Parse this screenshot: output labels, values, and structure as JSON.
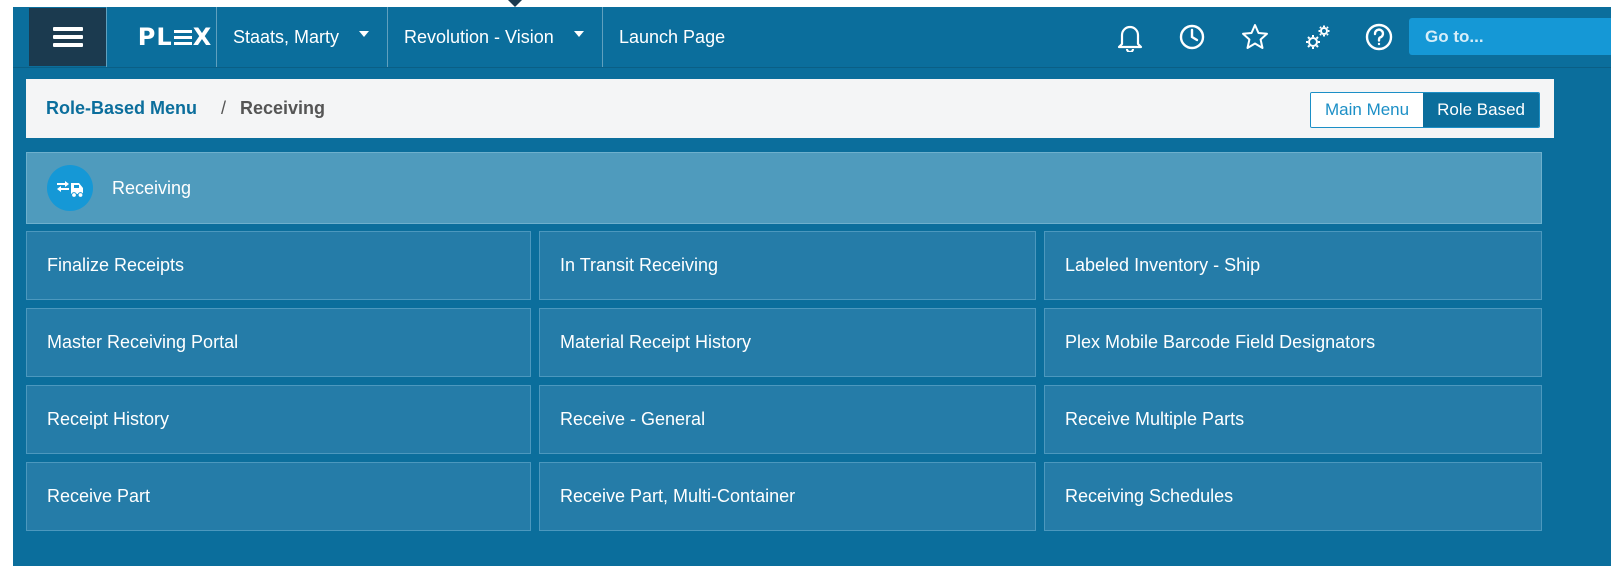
{
  "nav": {
    "logo": "PLEX",
    "user": "Staats, Marty",
    "workspace": "Revolution - Vision",
    "launch_page": "Launch Page",
    "goto_placeholder": "Go to...",
    "icons": [
      "bell-icon",
      "clock-icon",
      "star-icon",
      "gears-icon",
      "help-icon"
    ]
  },
  "breadcrumb": {
    "root": "Role-Based Menu",
    "separator": "/",
    "current": "Receiving"
  },
  "menu_toggle": {
    "main_menu": "Main Menu",
    "role_based": "Role Based",
    "active": "Role Based"
  },
  "section": {
    "title": "Receiving",
    "icon": "truck-arrows-icon"
  },
  "tiles": [
    "Finalize Receipts",
    "In Transit Receiving",
    "Labeled Inventory - Ship",
    "Master Receiving Portal",
    "Material Receipt History",
    "Plex Mobile Barcode Field Designators",
    "Receipt History",
    "Receive - General",
    "Receive Multiple Parts",
    "Receive Part",
    "Receive Part, Multi-Container",
    "Receiving Schedules"
  ],
  "colors": {
    "nav_bg": "#0b6e9c",
    "hamburger_bg": "#1b3a4f",
    "goto_bg": "#1598d6",
    "section_bg": "#4f9bbd",
    "tile_bg": "#257ca8"
  }
}
